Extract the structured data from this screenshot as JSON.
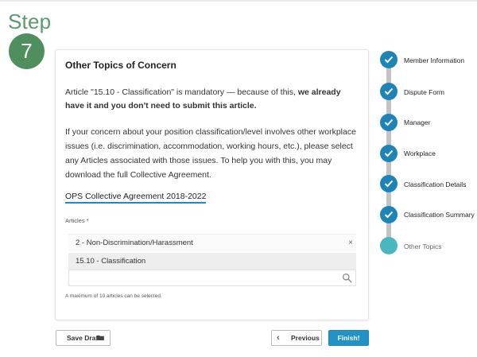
{
  "step": {
    "label": "Step",
    "number": "7"
  },
  "card": {
    "title": "Other Topics of Concern",
    "para1_prefix": "Article \"15.10 - Classification\" is mandatory — because of this, ",
    "para1_bold": "we already have it and you don't need to submit this article.",
    "para2": "If your concern about your position classification/level involves other workplace issues (i.e. discrimination, accommodation, working hours, etc.), please select any Articles associated with those issues. To help you with this, you may download the full Collective Agreement.",
    "link": "OPS Collective Agreement 2018-2022",
    "articles_label": "Articles *",
    "selected_articles": [
      "2 - Non-Discrimination/Harassment",
      "15.10 - Classification"
    ],
    "remove_symbol": "×",
    "search_placeholder": "",
    "help_text": "A maximum of 10 articles can be selected."
  },
  "buttons": {
    "save_draft": "Save Draft",
    "previous": "Previous",
    "finish": "Finish!"
  },
  "stepper": [
    {
      "label": "Member Information",
      "state": "done"
    },
    {
      "label": "Dispute Form",
      "state": "done"
    },
    {
      "label": "Manager",
      "state": "done"
    },
    {
      "label": "Workplace",
      "state": "done"
    },
    {
      "label": "Classification Details",
      "state": "done"
    },
    {
      "label": "Classification Summary",
      "state": "done"
    },
    {
      "label": "Other Topics",
      "state": "current"
    }
  ],
  "colors": {
    "step_green": "#4f8f5e",
    "accent_blue": "#2193c6",
    "current_teal": "#4ab7c0",
    "link_underline": "#1f8ac0"
  }
}
